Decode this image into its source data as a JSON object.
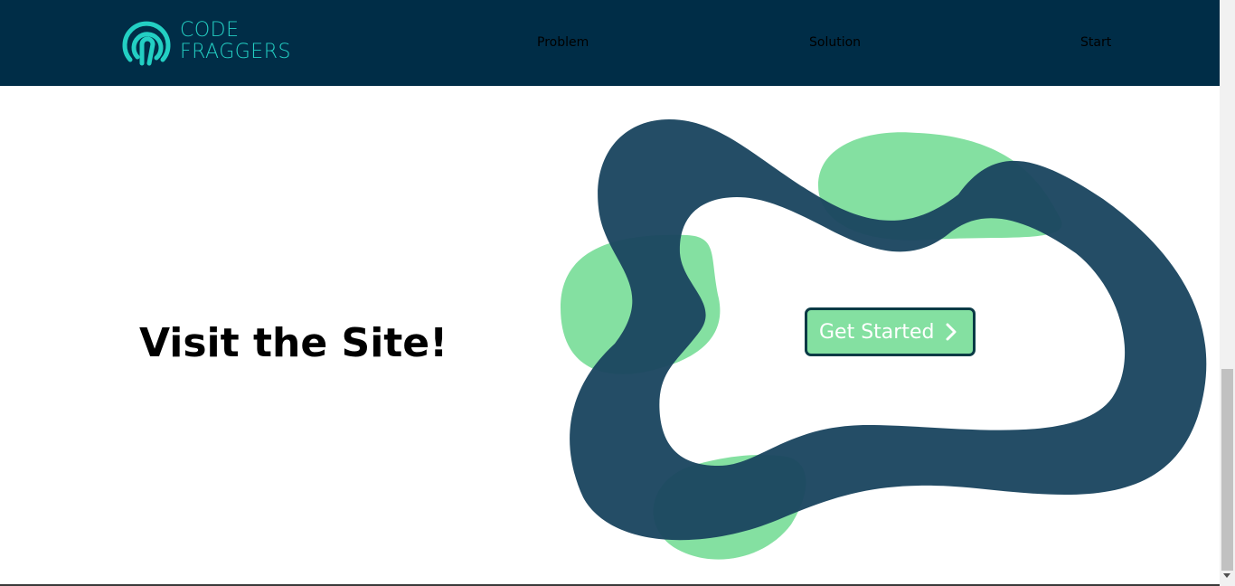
{
  "brand": {
    "line1": "CODE",
    "line2": "FRAGGERS",
    "logo_icon": "fingerprint-logo-icon"
  },
  "nav": {
    "items": [
      {
        "label": "Problem"
      },
      {
        "label": "Solution"
      },
      {
        "label": "Start"
      }
    ]
  },
  "hero": {
    "title": "Visit the Site!",
    "cta_label": "Get Started",
    "cta_icon": "chevron-right-icon"
  },
  "colors": {
    "navbar_bg": "#002d47",
    "brand_teal": "#23cfc3",
    "blob_navy": "#1b4660",
    "blob_green": "#84e0a1",
    "cta_bg": "#84e0a1",
    "cta_border": "#0a3a45"
  }
}
